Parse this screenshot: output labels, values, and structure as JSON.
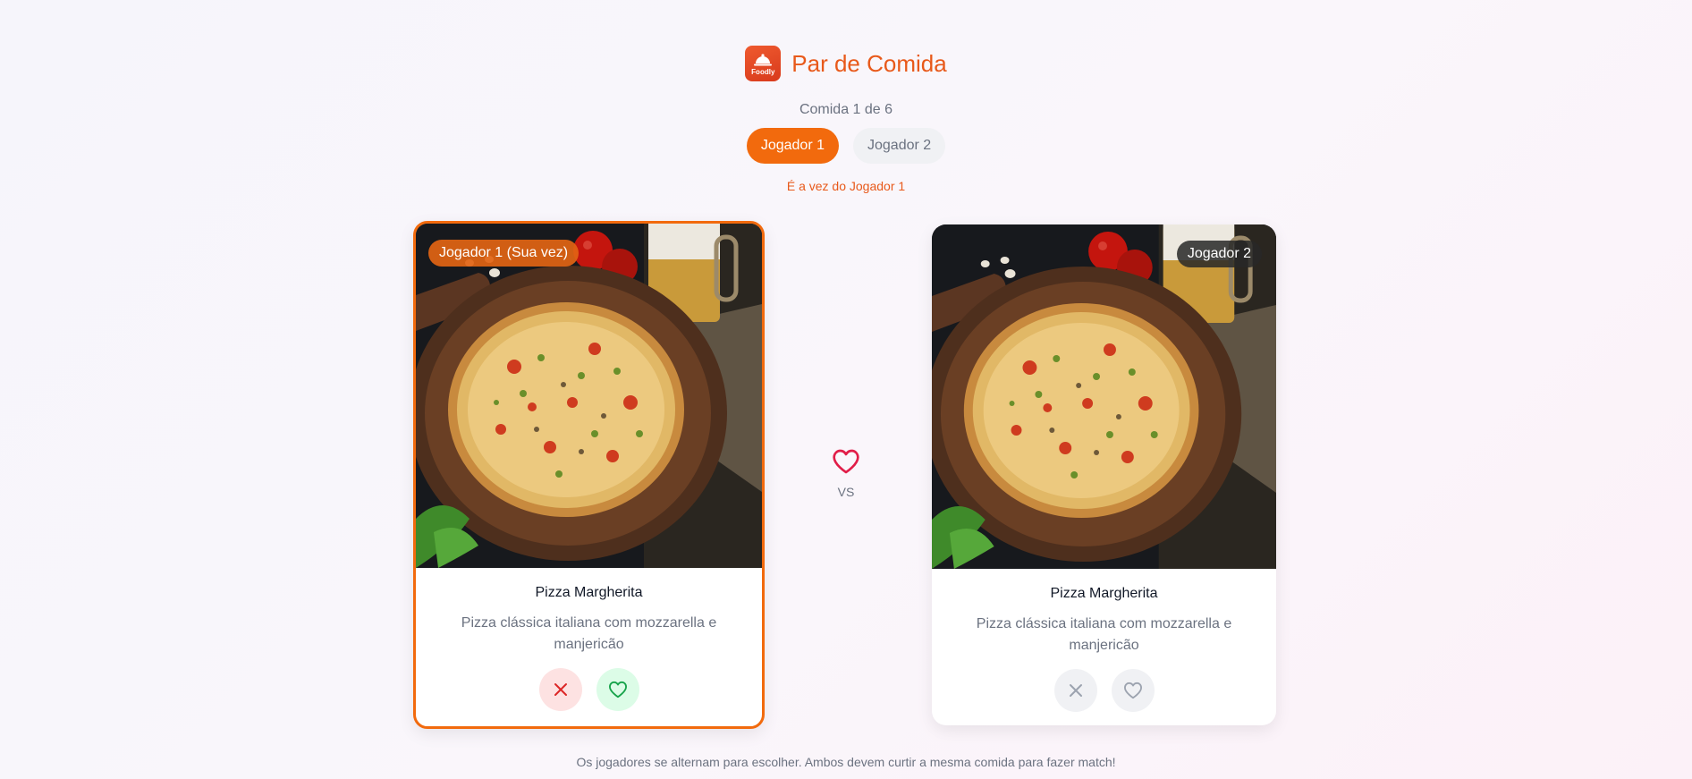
{
  "app": {
    "logo_text": "Foodly",
    "title": "Par de Comida",
    "counter": "Comida 1 de 6",
    "turn_message": "É a vez do Jogador 1",
    "footer": "Os jogadores se alternam para escolher. Ambos devem curtir a mesma comida para fazer match!"
  },
  "tabs": [
    {
      "label": "Jogador 1",
      "active": true
    },
    {
      "label": "Jogador 2",
      "active": false
    }
  ],
  "vs": {
    "label": "VS",
    "icon": "heart-icon"
  },
  "cards": [
    {
      "badge": "Jogador 1 (Sua vez)",
      "food_name": "Pizza Margherita",
      "food_desc": "Pizza clássica italiana com mozzarella e manjericão",
      "image": "pizza-photo",
      "enabled": true
    },
    {
      "badge": "Jogador 2",
      "food_name": "Pizza Margherita",
      "food_desc": "Pizza clássica italiana com mozzarella e manjericão",
      "image": "pizza-photo",
      "enabled": false
    }
  ],
  "colors": {
    "accent": "#f26a0d",
    "title": "#e8591a",
    "dislike": "#dc2626",
    "like": "#16a34a",
    "disabled": "#9ca3af"
  }
}
